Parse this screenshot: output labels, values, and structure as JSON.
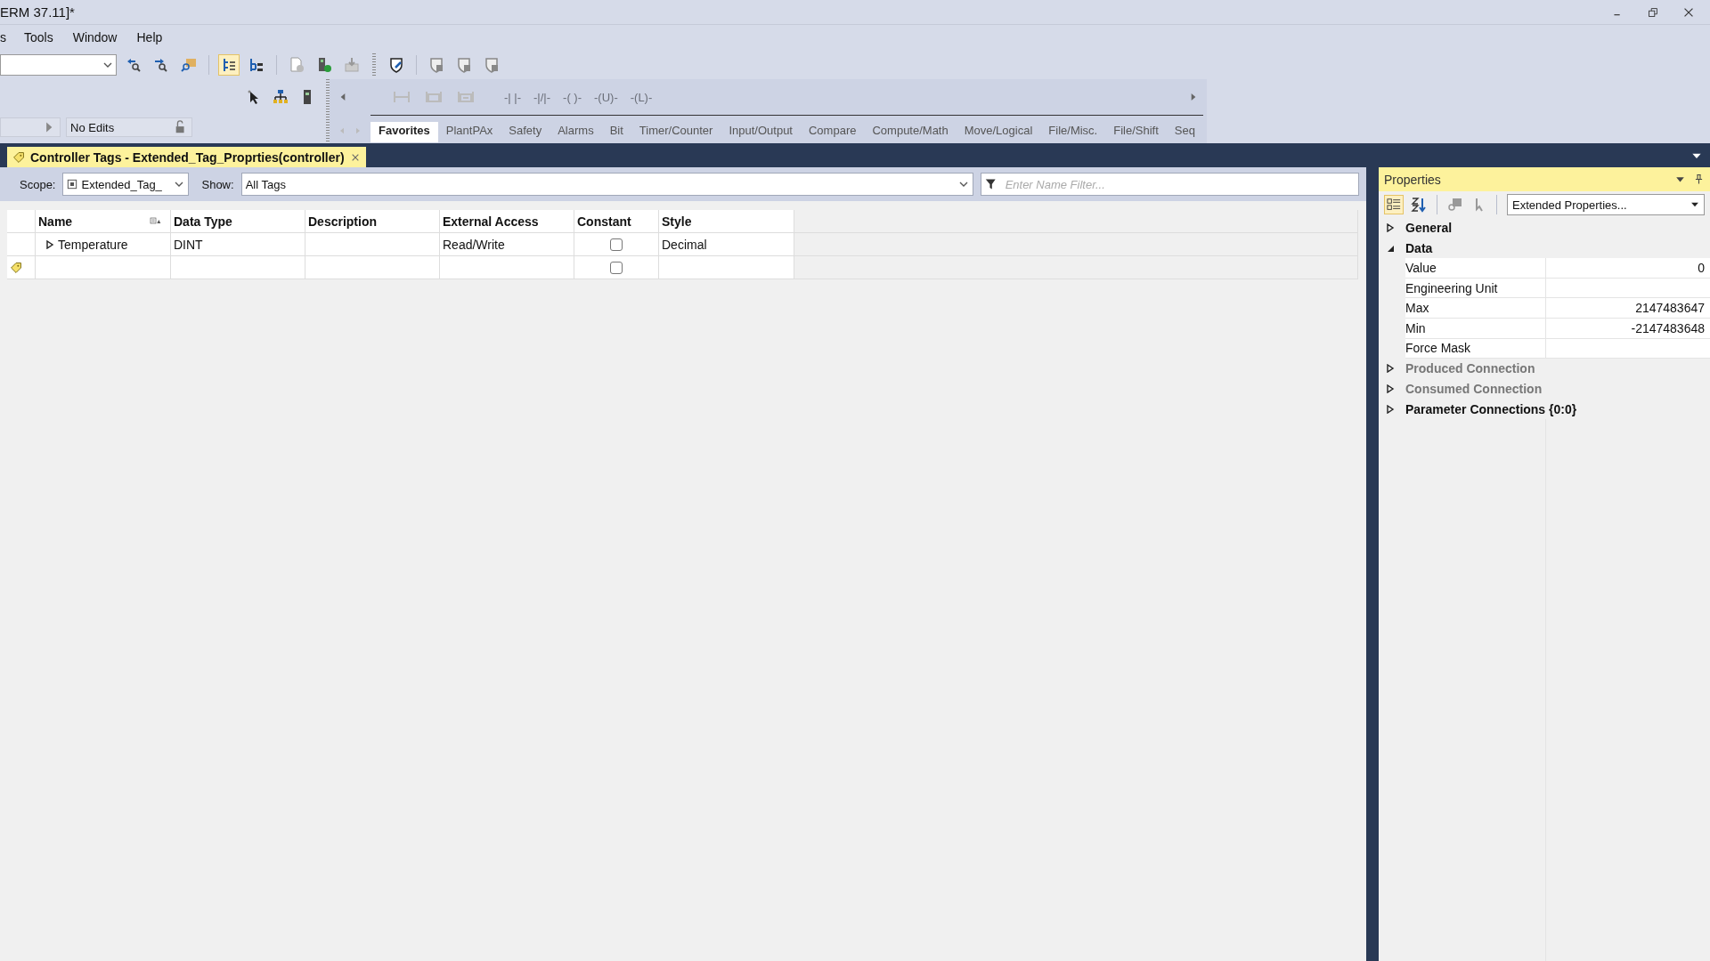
{
  "window": {
    "title": "ERM 37.11]*"
  },
  "menu": [
    {
      "label": "s"
    },
    {
      "label": "Tools"
    },
    {
      "label": "Window"
    },
    {
      "label": "Help"
    }
  ],
  "toolbar": {
    "tree_view_selected": true
  },
  "edit_status": "No Edits",
  "instruction_buttons": [
    "-| |-",
    "-|/|-",
    "-( )-",
    "-(U)-",
    "-(L)-"
  ],
  "instruction_tabs": [
    {
      "label": "Favorites",
      "selected": true
    },
    {
      "label": "PlantPAx",
      "selected": false
    },
    {
      "label": "Safety",
      "selected": false
    },
    {
      "label": "Alarms",
      "selected": false
    },
    {
      "label": "Bit",
      "selected": false
    },
    {
      "label": "Timer/Counter",
      "selected": false
    },
    {
      "label": "Input/Output",
      "selected": false
    },
    {
      "label": "Compare",
      "selected": false
    },
    {
      "label": "Compute/Math",
      "selected": false
    },
    {
      "label": "Move/Logical",
      "selected": false
    },
    {
      "label": "File/Misc.",
      "selected": false
    },
    {
      "label": "File/Shift",
      "selected": false
    },
    {
      "label": "Seq",
      "selected": false
    }
  ],
  "document_tab": {
    "title": "Controller Tags - Extended_Tag_Proprties(controller)"
  },
  "scope": {
    "label": "Scope:",
    "value": "Extended_Tag_"
  },
  "show": {
    "label": "Show:",
    "value": "All Tags"
  },
  "name_filter": {
    "placeholder": "Enter Name Filter..."
  },
  "table": {
    "columns": [
      "Name",
      "Data Type",
      "Description",
      "External Access",
      "Constant",
      "Style"
    ],
    "rows": [
      {
        "kind": "tag",
        "name": "Temperature",
        "data_type": "DINT",
        "external_access": "Read/Write",
        "constant": false,
        "style": "Decimal",
        "expanded": false
      },
      {
        "kind": "new",
        "constant": false
      }
    ]
  },
  "properties": {
    "title": "Properties",
    "view": "Extended Properties...",
    "groups": [
      {
        "label": "General",
        "expanded": false,
        "disabled": false
      },
      {
        "label": "Data",
        "expanded": true,
        "disabled": false,
        "children": [
          {
            "name": "Value",
            "value": "0"
          },
          {
            "name": "Engineering Unit"
          },
          {
            "name": "Max",
            "value": "2147483647"
          },
          {
            "name": "Min",
            "value": "-2147483648"
          },
          {
            "name": "Force Mask"
          }
        ]
      },
      {
        "label": "Produced Connection",
        "expanded": false,
        "disabled": true
      },
      {
        "label": "Consumed Connection",
        "expanded": false,
        "disabled": true
      },
      {
        "label": "Parameter Connections {0:0}",
        "expanded": false,
        "disabled": false
      }
    ]
  }
}
